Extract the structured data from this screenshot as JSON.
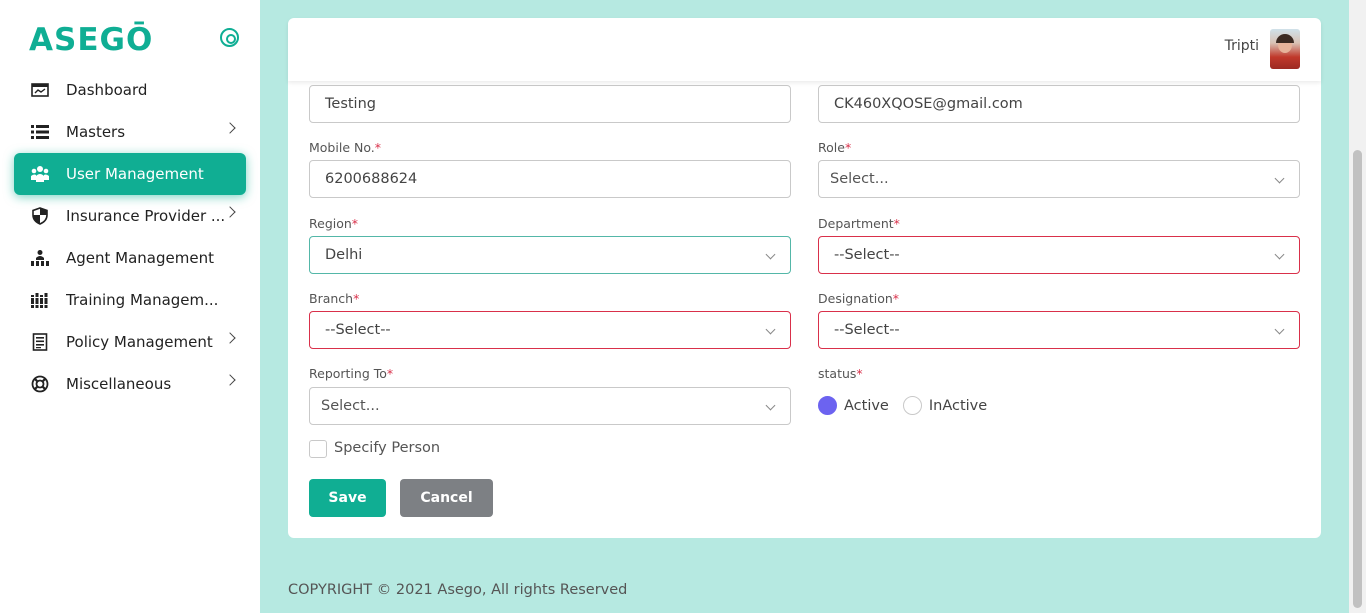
{
  "brand": {
    "logo_text": "ASEGŌ",
    "accent": "#10ae93"
  },
  "sidebar": {
    "items": [
      {
        "label": "Dashboard",
        "icon": "dashboard-icon",
        "active": false,
        "has_submenu": false
      },
      {
        "label": "Masters",
        "icon": "list-icon",
        "active": false,
        "has_submenu": true
      },
      {
        "label": "User Management",
        "icon": "users-icon",
        "active": true,
        "has_submenu": false
      },
      {
        "label": "Insurance Provider ...",
        "icon": "shield-icon",
        "active": false,
        "has_submenu": true
      },
      {
        "label": "Agent Management",
        "icon": "agent-icon",
        "active": false,
        "has_submenu": false
      },
      {
        "label": "Training Managem...",
        "icon": "books-icon",
        "active": false,
        "has_submenu": false
      },
      {
        "label": "Policy Management",
        "icon": "document-icon",
        "active": false,
        "has_submenu": true
      },
      {
        "label": "Miscellaneous",
        "icon": "lifebuoy-icon",
        "active": false,
        "has_submenu": true
      }
    ]
  },
  "header": {
    "user_name": "Tripti"
  },
  "form": {
    "name_value": "Testing",
    "email_value": "CK460XQOSE@gmail.com",
    "mobile_label": "Mobile No.",
    "mobile_value": "6200688624",
    "role_label": "Role",
    "role_placeholder": "Select...",
    "region_label": "Region",
    "region_value": "Delhi",
    "department_label": "Department",
    "department_value": "--Select--",
    "branch_label": "Branch",
    "branch_value": "--Select--",
    "designation_label": "Designation",
    "designation_value": "--Select--",
    "reporting_label": "Reporting To",
    "reporting_placeholder": "Select...",
    "status_label": "status",
    "status_options": [
      "Active",
      "InActive"
    ],
    "status_selected": "Active",
    "specify_person_label": "Specify Person",
    "required_mark": "*"
  },
  "actions": {
    "save_label": "Save",
    "cancel_label": "Cancel"
  },
  "footer": {
    "copyright": "COPYRIGHT © 2021 Asego, All rights Reserved"
  }
}
